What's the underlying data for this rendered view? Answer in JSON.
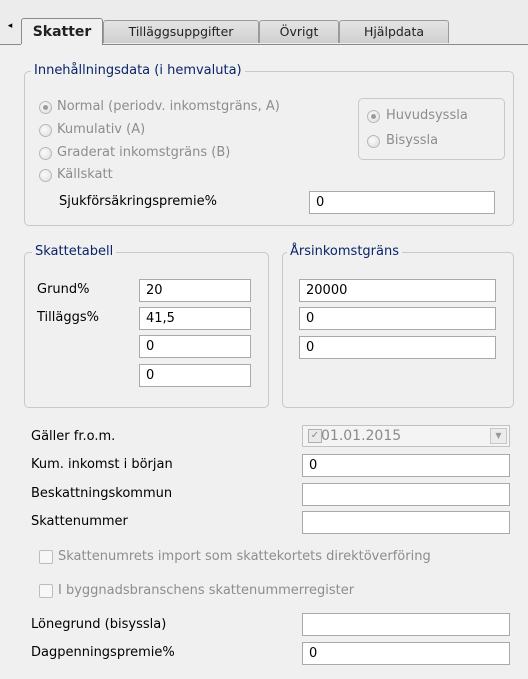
{
  "tabs": {
    "scroll_glyph": "◂",
    "items": [
      {
        "label": "Skatter",
        "active": true
      },
      {
        "label": "Tilläggsuppgifter",
        "active": false
      },
      {
        "label": "Övrigt",
        "active": false
      },
      {
        "label": "Hjälpdata",
        "active": false
      }
    ]
  },
  "withholding": {
    "title": "Innehållningsdata (i hemvaluta)",
    "methods": [
      {
        "label": "Normal (periodv. inkomstgräns, A)",
        "selected": true
      },
      {
        "label": "Kumulativ (A)",
        "selected": false
      },
      {
        "label": "Graderat inkomstgräns (B)",
        "selected": false
      },
      {
        "label": "Källskatt",
        "selected": false
      }
    ],
    "employment": [
      {
        "label": "Huvudsyssla",
        "selected": true
      },
      {
        "label": "Bisyssla",
        "selected": false
      }
    ],
    "sickness_premium_label": "Sjukförsäkringspremie%",
    "sickness_premium_value": "0"
  },
  "tax_table": {
    "title": "Skattetabell",
    "base_label": "Grund%",
    "base_value": "20",
    "additional_label": "Tilläggs%",
    "additional_value": "41,5",
    "extra_values": [
      "0",
      "0"
    ]
  },
  "annual_income_limit": {
    "title": "Årsinkomstgräns",
    "values": [
      "20000",
      "0",
      "0"
    ]
  },
  "details": {
    "valid_from_label": "Gäller fr.o.m.",
    "valid_from_value": "01.01.2015",
    "valid_from_check_glyph": "✓",
    "dropdown_glyph": "▼",
    "cumulative_income_label": "Kum. inkomst i början",
    "cumulative_income_value": "0",
    "municipality_label": "Beskattningskommun",
    "municipality_value": "",
    "tax_number_label": "Skattenummer",
    "tax_number_value": "",
    "import_checkbox_label": "Skattenumrets import som skattekortets direktöverföring",
    "construction_checkbox_label": "I byggnadsbranschens skattenummerregister",
    "salary_basis_label": "Lönegrund (bisyssla)",
    "salary_basis_value": "",
    "daily_allowance_label": "Dagpenningspremie%",
    "daily_allowance_value": "0"
  }
}
